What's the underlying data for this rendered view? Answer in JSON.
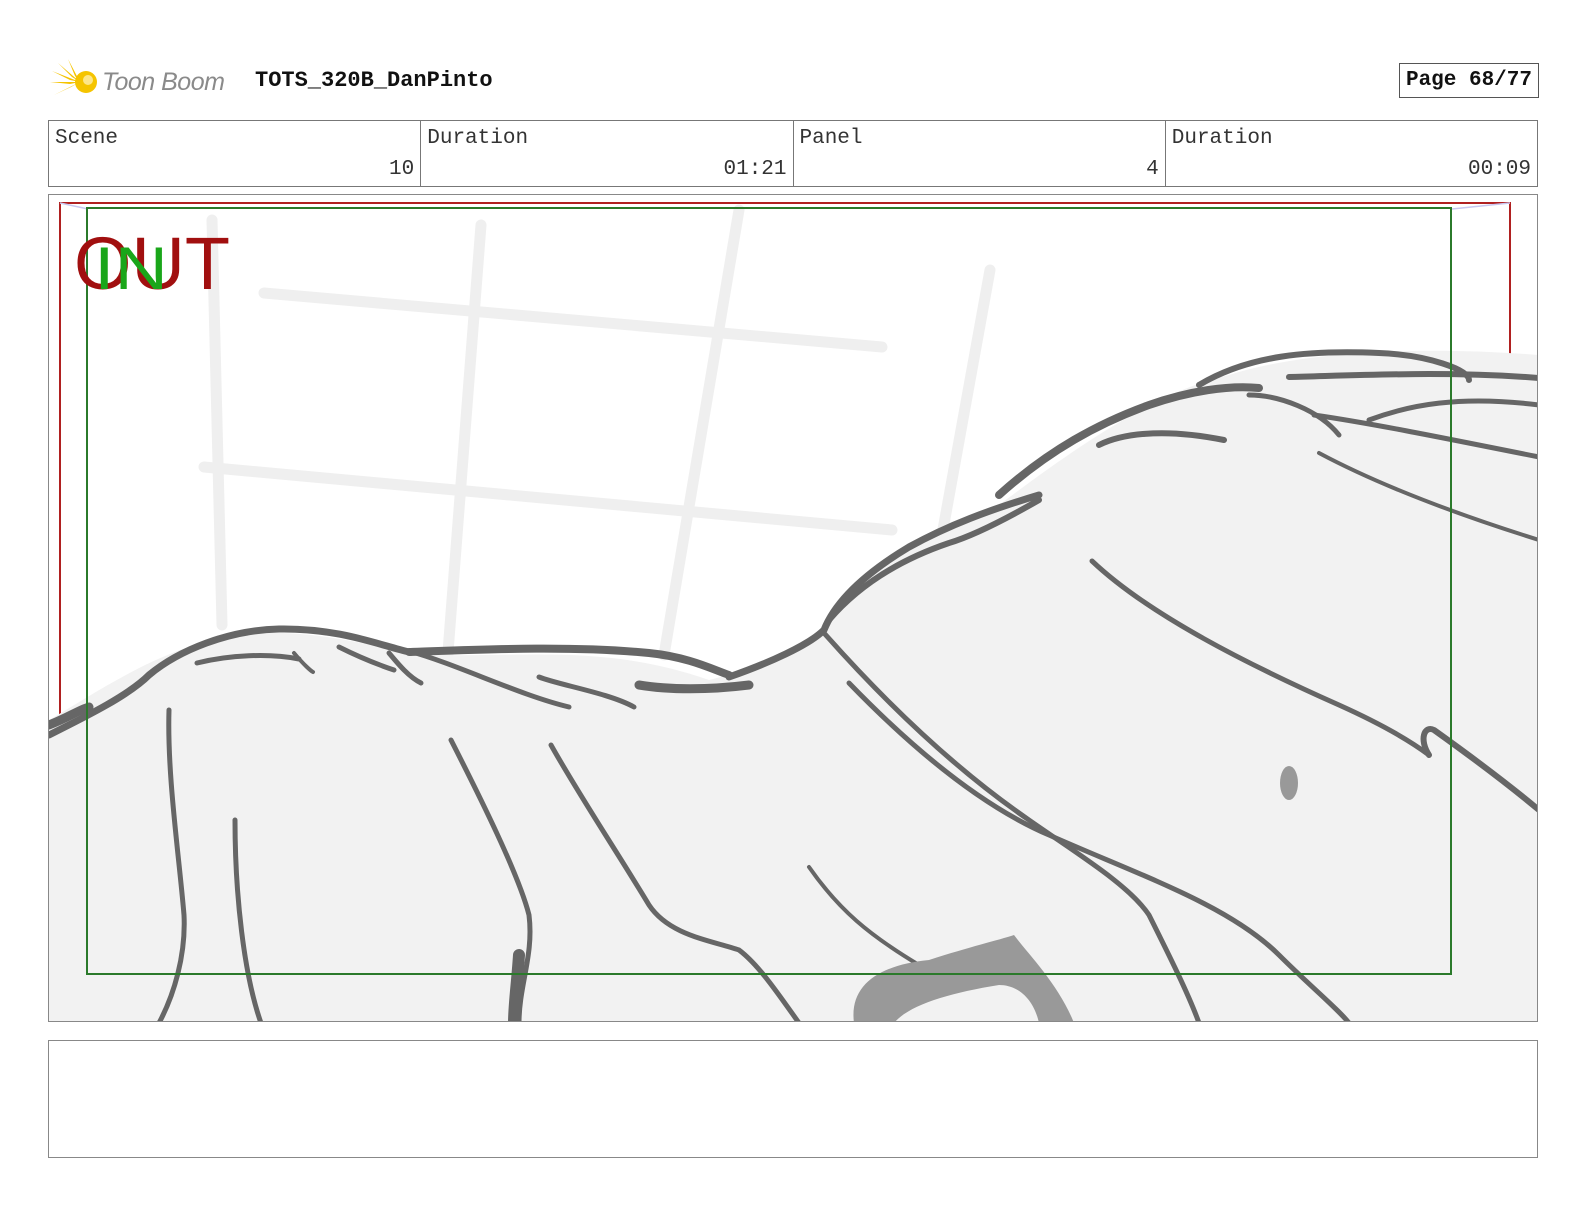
{
  "header": {
    "logo_text": "Toon Boom",
    "project_title": "TOTS_320B_DanPinto",
    "page_label": "Page 68/77"
  },
  "info": {
    "scene_label": "Scene",
    "scene_value": "10",
    "scene_duration_label": "Duration",
    "scene_duration_value": "01:21",
    "panel_label": "Panel",
    "panel_value": "4",
    "panel_duration_label": "Duration",
    "panel_duration_value": "00:09"
  },
  "panel": {
    "overlay_out": "OUT",
    "overlay_in": "IN",
    "colors": {
      "out_text": "#a10f0f",
      "in_text": "#1aa61a",
      "safe_frame": "#2b7a2b",
      "camera_frame": "#b02020",
      "sketch": "#666666",
      "fill": "#f2f2f2"
    }
  },
  "notes": {
    "text": ""
  }
}
